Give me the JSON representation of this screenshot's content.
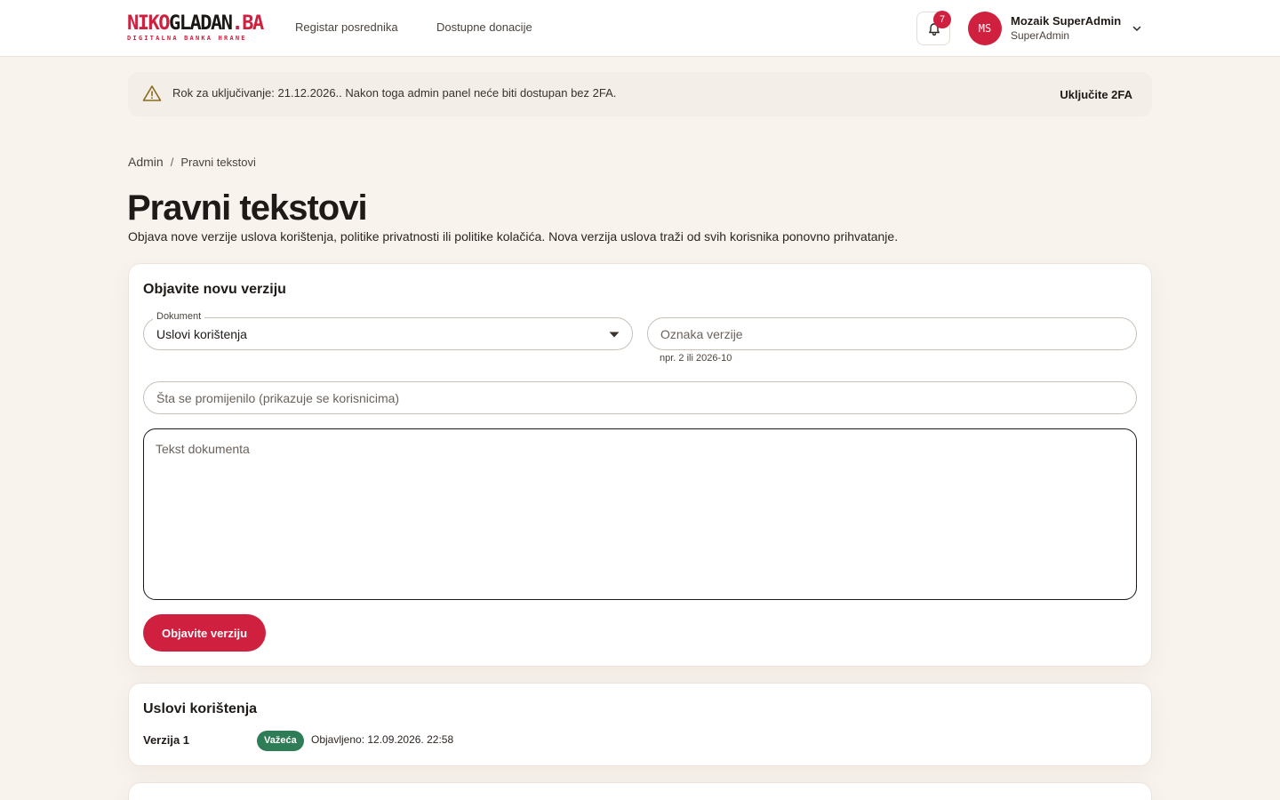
{
  "header": {
    "logo": {
      "part1": "NIKO",
      "part2": "GLADAN",
      "part3": ".BA",
      "tagline": "DIGITALNA BANKA HRANE"
    },
    "nav": [
      {
        "label": "Registar posrednika"
      },
      {
        "label": "Dostupne donacije"
      }
    ],
    "notifications": {
      "count": "7",
      "icon": "bell-icon"
    },
    "user": {
      "initials": "MS",
      "name": "Mozaik SuperAdmin",
      "role": "SuperAdmin"
    }
  },
  "alert": {
    "icon": "warning-icon",
    "text": "Rok za uključivanje: 21.12.2026.. Nakon toga admin panel neće biti dostupan bez 2FA.",
    "action": "Uključite 2FA"
  },
  "breadcrumb": {
    "root": "Admin",
    "separator": "/",
    "current": "Pravni tekstovi"
  },
  "page": {
    "title": "Pravni tekstovi",
    "description": "Objava nove verzije uslova korištenja, politike privatnosti ili politike kolačića. Nova verzija uslova traži od svih korisnika ponovno prihvatanje."
  },
  "form": {
    "title": "Objavite novu verziju",
    "document": {
      "label": "Dokument",
      "value": "Uslovi korištenja"
    },
    "version": {
      "placeholder": "Oznaka verzije",
      "helper": "npr. 2 ili 2026-10"
    },
    "changes": {
      "placeholder": "Šta se promijenilo (prikazuje se korisnicima)"
    },
    "body": {
      "placeholder": "Tekst dokumenta"
    },
    "submit": "Objavite verziju"
  },
  "documents": [
    {
      "title": "Uslovi korištenja",
      "versions": [
        {
          "label": "Verzija 1",
          "status": "Važeća",
          "published": "Objavljeno: 12.09.2026. 22:58"
        }
      ]
    }
  ],
  "colors": {
    "brand": "#d0203f",
    "background": "#f8f3ed",
    "status_current": "#2f7d57",
    "alert_bg": "#f3eee7"
  }
}
